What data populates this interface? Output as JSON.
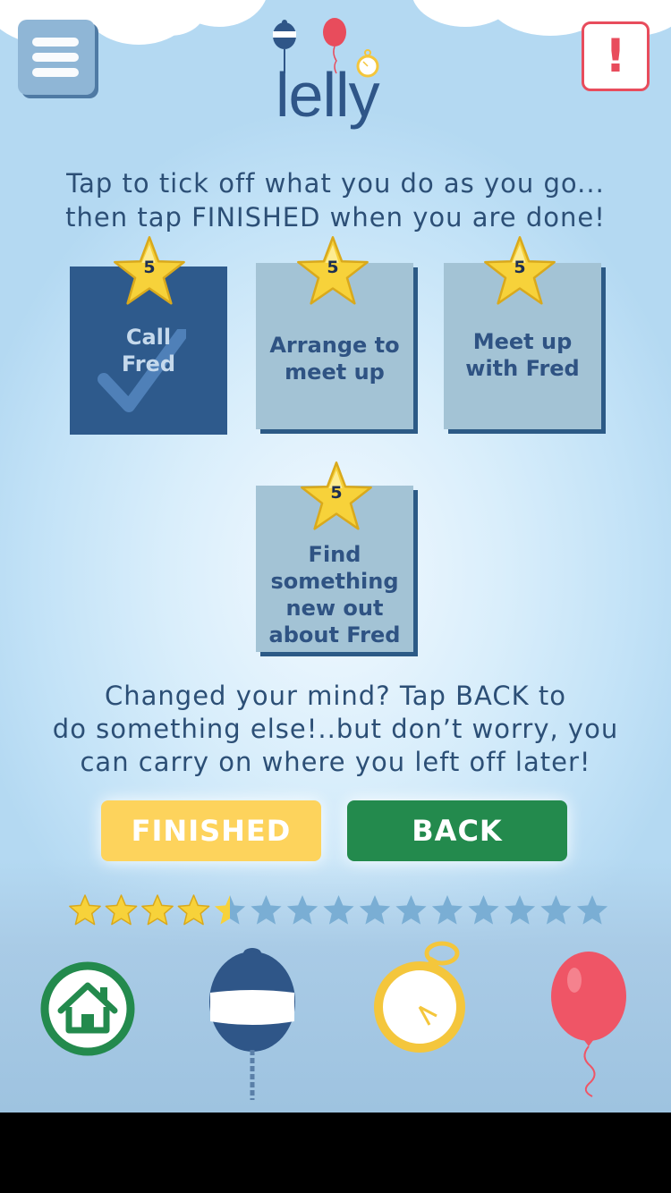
{
  "app": {
    "logo": "lelly"
  },
  "header": {
    "menu_icon": "hamburger-icon",
    "alert_label": "!"
  },
  "instructions": [
    "Tap to tick off what you do as you go...",
    "then tap FINISHED when you are done!"
  ],
  "tasks": [
    {
      "label_lines": [
        "Call",
        "Fred"
      ],
      "points": "5",
      "completed": true
    },
    {
      "label_lines": [
        "Arrange to",
        "meet up"
      ],
      "points": "5",
      "completed": false
    },
    {
      "label_lines": [
        "Meet up",
        "with Fred"
      ],
      "points": "5",
      "completed": false
    },
    {
      "label_lines": [
        "Find",
        "something",
        "new out",
        "about Fred"
      ],
      "points": "5",
      "completed": false
    }
  ],
  "back_message": [
    "Changed your mind? Tap BACK to",
    "do something else!..but don’t worry, you",
    "can carry on where you left off later!"
  ],
  "buttons": {
    "finished": "FINISHED",
    "back": "BACK"
  },
  "progress": {
    "total_stars": 15,
    "filled_stars": 4.5
  },
  "bottom_nav": [
    {
      "name": "home",
      "icon": "home-icon"
    },
    {
      "name": "buoy",
      "icon": "buoy-icon"
    },
    {
      "name": "stopwatch",
      "icon": "stopwatch-icon"
    },
    {
      "name": "balloon",
      "icon": "balloon-icon"
    }
  ],
  "colors": {
    "accent_blue": "#2f5688",
    "alert_red": "#e84c5c",
    "finished_yellow": "#fdd35c",
    "back_green": "#238a4d",
    "star_gold": "#f7d23a"
  }
}
